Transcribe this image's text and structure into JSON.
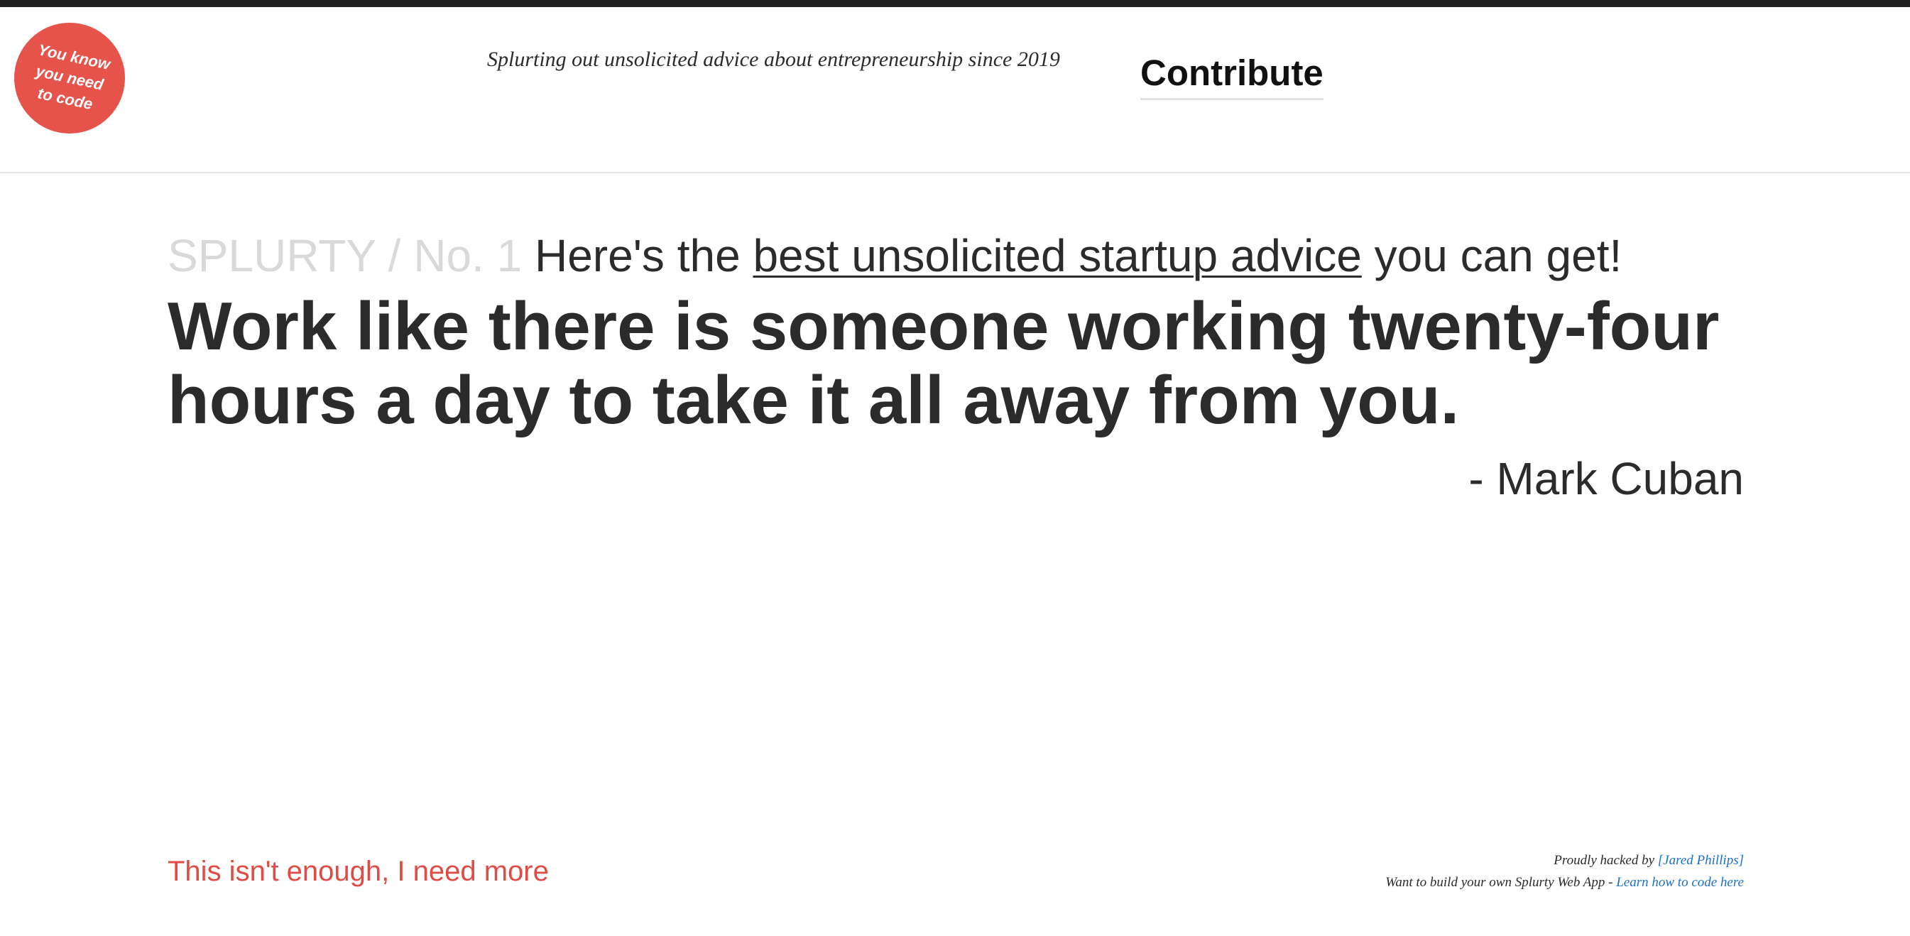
{
  "header": {
    "badge": {
      "lines": [
        "You know",
        "you need",
        "to code"
      ],
      "color": "#e5534b"
    },
    "tagline": "Splurting out unsolicited advice about entrepreneurship since 2019",
    "contribute_label": "Contribute"
  },
  "main": {
    "label": "SPLURTY / No. 1",
    "intro_before": "Here's the",
    "intro_link": "best unsolicited startup advice",
    "intro_after": "you can get!",
    "quote": "Work like there is someone working twenty-four hours a day to take it all away from you.",
    "author": "- Mark Cuban"
  },
  "footer": {
    "more_link": "This isn't enough, I need more",
    "credit_prefix": "Proudly hacked by",
    "credit_name": "[Jared Phillips]",
    "build_prefix": "Want to build your own Splurty Web App -",
    "build_link": "Learn how to code here",
    "accent_color": "#e04b45",
    "link_color": "#1a6fd1"
  }
}
